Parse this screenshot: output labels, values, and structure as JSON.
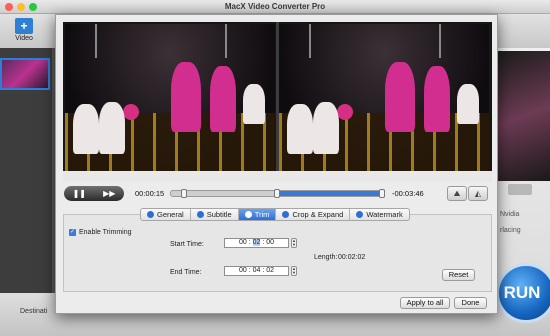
{
  "app": {
    "title": "MacX Video Converter Pro"
  },
  "toolbar": {
    "video_label": "Video"
  },
  "background": {
    "nvidia_text": "Nvidia",
    "deinterlacing_text": "rlacing",
    "destination_label": "Destinati",
    "run_label": "RUN"
  },
  "player": {
    "current_time": "00:00:15",
    "remaining_time": "-00:03:46"
  },
  "tabs": [
    {
      "label": "General",
      "active": false
    },
    {
      "label": "Subtitle",
      "active": false
    },
    {
      "label": "Trim",
      "active": true
    },
    {
      "label": "Crop & Expand",
      "active": false
    },
    {
      "label": "Watermark",
      "active": false
    }
  ],
  "trim": {
    "enable_label": "Enable Trimming",
    "enabled": true,
    "start_label": "Start Time:",
    "start": {
      "h": "00",
      "m": "02",
      "s": "00"
    },
    "end_label": "End Time:",
    "end": {
      "h": "00",
      "m": "04",
      "s": "02"
    },
    "length_label": "Length:",
    "length_value": "00:02:02",
    "reset_label": "Reset"
  },
  "dialog": {
    "apply_all_label": "Apply to all",
    "done_label": "Done"
  },
  "colors": {
    "accent": "#2e6fd6",
    "selected_range": "#3b77d4"
  }
}
